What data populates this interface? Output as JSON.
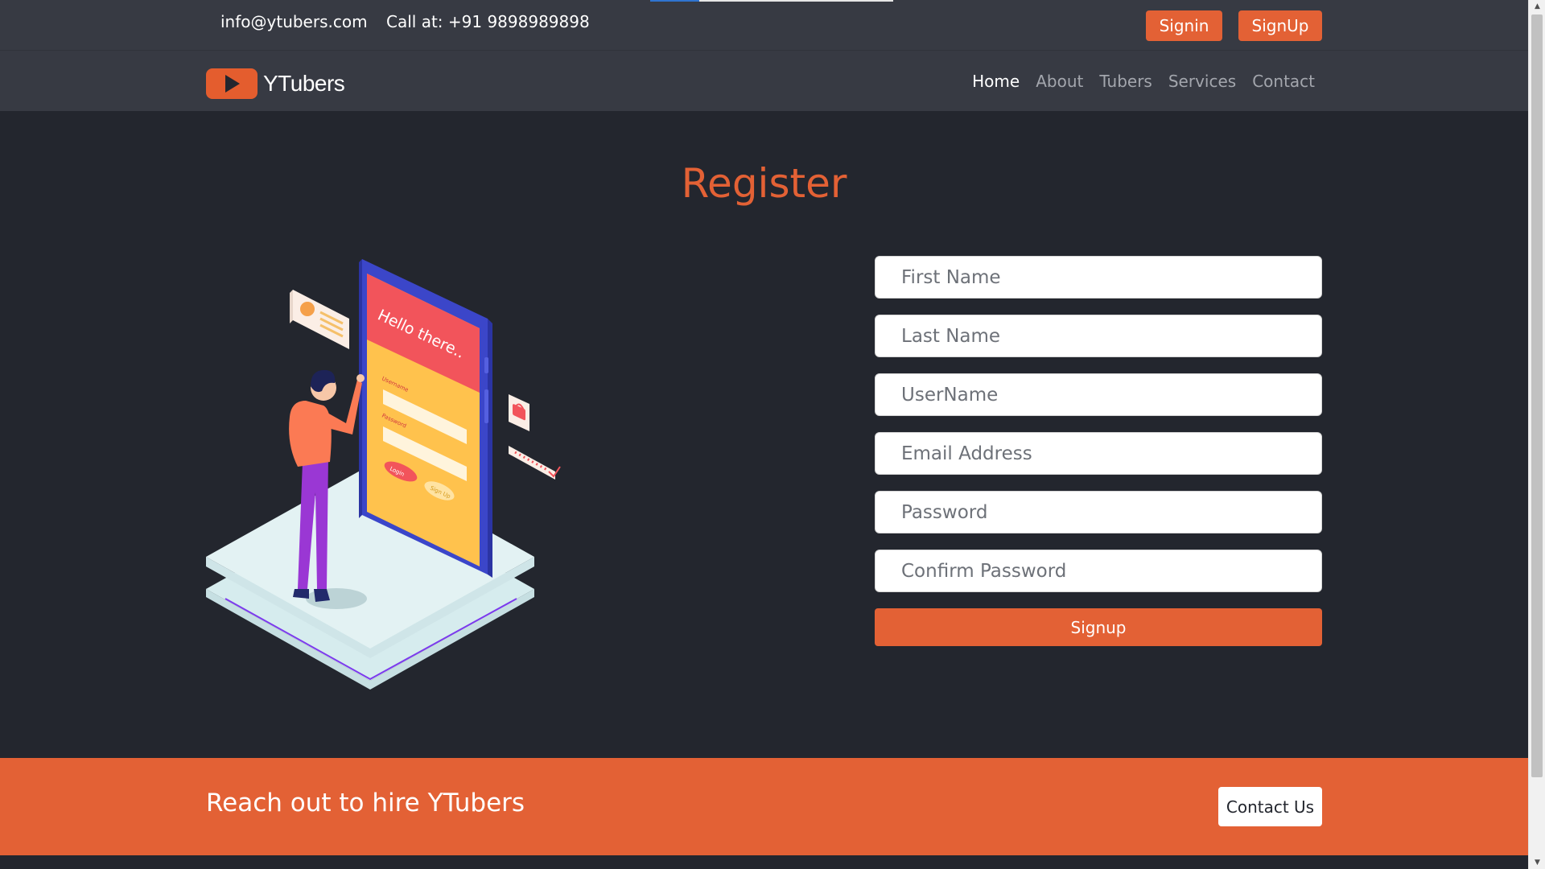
{
  "topbar": {
    "email": "info@ytubers.com",
    "phone": "Call at: +91 9898989898",
    "signin_label": "Signin",
    "signup_label": "SignUp"
  },
  "navbar": {
    "brand": "YTubers",
    "links": [
      "Home",
      "About",
      "Tubers",
      "Services",
      "Contact"
    ],
    "active": "Home"
  },
  "main": {
    "title": "Register",
    "illustration": {
      "screen_heading": "Hello there..",
      "username_label": "Username",
      "password_label": "Password",
      "login_label": "Login",
      "signup_label": "Sign Up"
    },
    "form": {
      "first_name_placeholder": "First Name",
      "last_name_placeholder": "Last Name",
      "username_placeholder": "UserName",
      "email_placeholder": "Email Address",
      "password_placeholder": "Password",
      "confirm_password_placeholder": "Confirm Password",
      "submit_label": "Signup"
    }
  },
  "cta": {
    "text": "Reach out to hire YTubers",
    "button_label": "Contact Us"
  },
  "colors": {
    "accent": "#e36135",
    "page_background": "#23262e",
    "navbar_background": "#373a43"
  },
  "icons": [
    "play-logo-icon",
    "scroll-up-arrow-icon",
    "scroll-down-arrow-icon"
  ]
}
